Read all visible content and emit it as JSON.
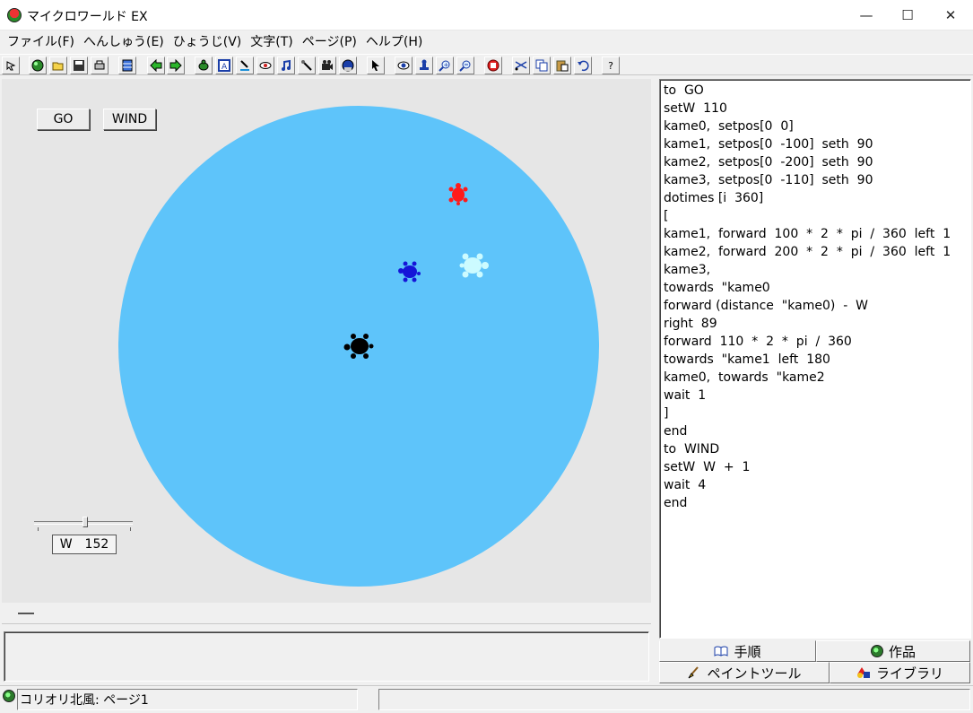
{
  "window": {
    "title": "マイクロワールド EX",
    "minimize": "—",
    "maximize": "☐",
    "close": "✕"
  },
  "menu": [
    "ファイル(F)",
    "へんしゅう(E)",
    "ひょうじ(V)",
    "文字(T)",
    "ページ(P)",
    "ヘルプ(H)"
  ],
  "toolbar": {
    "icons": [
      "pointer-arrow",
      "globe",
      "open-folder",
      "save-disk",
      "print",
      "table",
      "back-arrow",
      "forward-arrow",
      "turtle",
      "text-box",
      "paintbrush",
      "eye",
      "music-note",
      "draw-tool",
      "film-camera",
      "video-globe",
      "select-arrow",
      "hide-eye",
      "stamp",
      "zoom-in",
      "zoom-out",
      "stop-hand",
      "cut-scissors",
      "copy",
      "paste",
      "undo",
      "help"
    ],
    "help_label": "?"
  },
  "canvas": {
    "go_button": "GO",
    "wind_button": "WIND",
    "slider": {
      "name": "W",
      "value": "152"
    },
    "colors": {
      "background": "#5ec4fa",
      "kame0": "#000000",
      "kame1": "#ff1a1a",
      "kame2": "#1515d8",
      "kame3": "#ccfbff"
    }
  },
  "code": [
    "to  GO",
    "setW  110",
    "kame0,  setpos[0  0]",
    "kame1,  setpos[0  -100]  seth  90",
    "kame2,  setpos[0  -200]  seth  90",
    "kame3,  setpos[0  -110]  seth  90",
    "dotimes [i  360]",
    "[",
    "kame1,  forward  100  *  2  *  pi  /  360  left  1",
    "kame2,  forward  200  *  2  *  pi  /  360  left  1",
    "kame3,",
    "towards  \"kame0",
    "forward (distance  \"kame0)  -  W",
    "right  89",
    "forward  110  *  2  *  pi  /  360",
    "towards  \"kame1  left  180",
    "kame0,  towards  \"kame2",
    "wait  1",
    "]",
    "end",
    "to  WIND",
    "setW  W  +  1",
    "wait  4",
    "end"
  ],
  "tabs": {
    "procedures": "手順",
    "project": "作品",
    "paint_tools": "ペイントツール",
    "library": "ライブラリ"
  },
  "status": {
    "text": "コリオリ北風:  ページ1"
  }
}
